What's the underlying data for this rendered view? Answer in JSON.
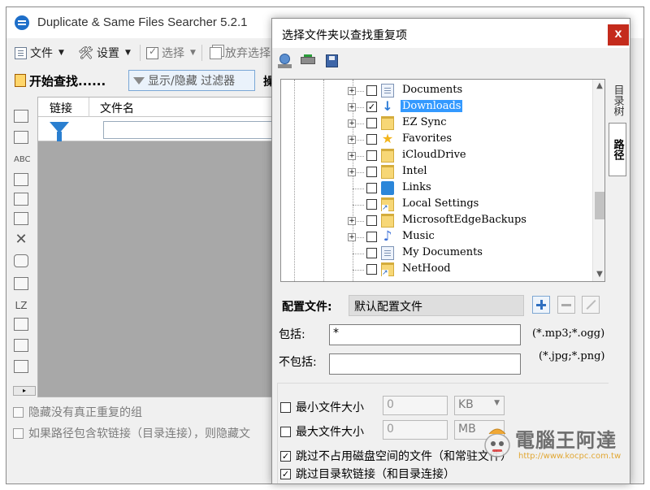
{
  "main": {
    "title": "Duplicate & Same Files Searcher 5.2.1",
    "menu": {
      "file": "文件",
      "settings": "设置",
      "select": "选择",
      "deselect": "放弃选择"
    },
    "toolbar": {
      "start_search": "开始查找......",
      "toggle_filter": "显示/隐藏 过滤器",
      "extra": "操"
    },
    "grid": {
      "col_link": "链接",
      "col_filename": "文件名",
      "filter_value": ""
    },
    "strip_text_1": "ABC",
    "strip_text_2": "LZ",
    "options": [
      {
        "label": "隐藏没有真正重复的组",
        "checked": false
      },
      {
        "label": "如果路径包含软链接（目录连接），则隐藏文",
        "checked": false
      }
    ]
  },
  "dialog": {
    "title": "选择文件夹以查找重复项",
    "close": "x",
    "tabs": {
      "tree": "目录树",
      "path": "路径"
    },
    "tree_items": [
      {
        "label": "Documents",
        "icon": "doc-folder-icon",
        "checked": false,
        "expandable": true,
        "selected": false
      },
      {
        "label": "Downloads",
        "icon": "download-arrow-icon",
        "checked": true,
        "expandable": true,
        "selected": true
      },
      {
        "label": "EZ Sync",
        "icon": "folder-icon",
        "checked": false,
        "expandable": true,
        "selected": false
      },
      {
        "label": "Favorites",
        "icon": "star-icon",
        "checked": false,
        "expandable": true,
        "selected": false
      },
      {
        "label": "iCloudDrive",
        "icon": "folder-icon",
        "checked": false,
        "expandable": true,
        "selected": false
      },
      {
        "label": "Intel",
        "icon": "folder-icon",
        "checked": false,
        "expandable": true,
        "selected": false
      },
      {
        "label": "Links",
        "icon": "links-icon",
        "checked": false,
        "expandable": false,
        "selected": false
      },
      {
        "label": "Local Settings",
        "icon": "folder-shortcut-icon",
        "checked": false,
        "expandable": false,
        "selected": false
      },
      {
        "label": "MicrosoftEdgeBackups",
        "icon": "folder-icon",
        "checked": false,
        "expandable": true,
        "selected": false
      },
      {
        "label": "Music",
        "icon": "music-note-icon",
        "checked": false,
        "expandable": true,
        "selected": false
      },
      {
        "label": "My Documents",
        "icon": "doc-shortcut-icon",
        "checked": false,
        "expandable": false,
        "selected": false
      },
      {
        "label": "NetHood",
        "icon": "folder-shortcut-icon",
        "checked": false,
        "expandable": false,
        "selected": false
      }
    ],
    "profile": {
      "label": "配置文件:",
      "value": "默认配置文件"
    },
    "include": {
      "label": "包括:",
      "value": "*",
      "hint": "(*.mp3;*.ogg)"
    },
    "exclude": {
      "label": "不包括:",
      "value": "",
      "hint": "(*.jpg;*.png)"
    },
    "min_size": {
      "label": "最小文件大小",
      "checked": false,
      "value": "0",
      "unit": "KB"
    },
    "max_size": {
      "label": "最大文件大小",
      "checked": false,
      "value": "0",
      "unit": "MB"
    },
    "skip_sparse": {
      "label": "跳过不占用磁盘空间的文件（和常驻文件）",
      "checked": true
    },
    "skip_links": {
      "label": "跳过目录软链接（和目录连接）",
      "checked": true
    }
  },
  "watermark": {
    "title": "電腦王阿達",
    "url": "http://www.kocpc.com.tw"
  }
}
